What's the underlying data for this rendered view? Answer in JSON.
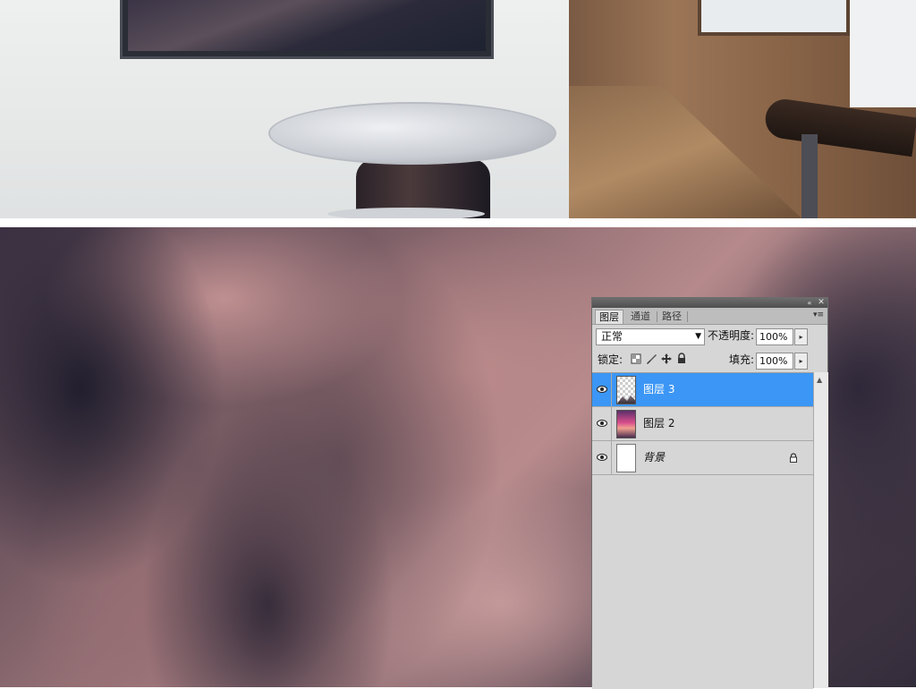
{
  "panel": {
    "tabs": [
      {
        "label": "图层",
        "active": true
      },
      {
        "label": "通道",
        "active": false
      },
      {
        "label": "路径",
        "active": false
      }
    ],
    "collapse_icon": "«",
    "close_icon": "✕",
    "menu_icon": "▾≡",
    "blend_mode": "正常",
    "opacity_label": "不透明度:",
    "opacity_value": "100%",
    "lock_label": "锁定:",
    "fill_label": "填充:",
    "fill_value": "100%",
    "stepper_icon": "▸",
    "scroll_up_icon": "▲",
    "layers": [
      {
        "name": "图层 3",
        "selected": true,
        "thumb": "transparent-with-mountain",
        "visible": true
      },
      {
        "name": "图层 2",
        "selected": false,
        "thumb": "sunset-photo",
        "visible": true
      },
      {
        "name": "背景",
        "selected": false,
        "thumb": "white",
        "visible": true,
        "locked": true
      }
    ],
    "accent_color": "#3b96f5"
  }
}
